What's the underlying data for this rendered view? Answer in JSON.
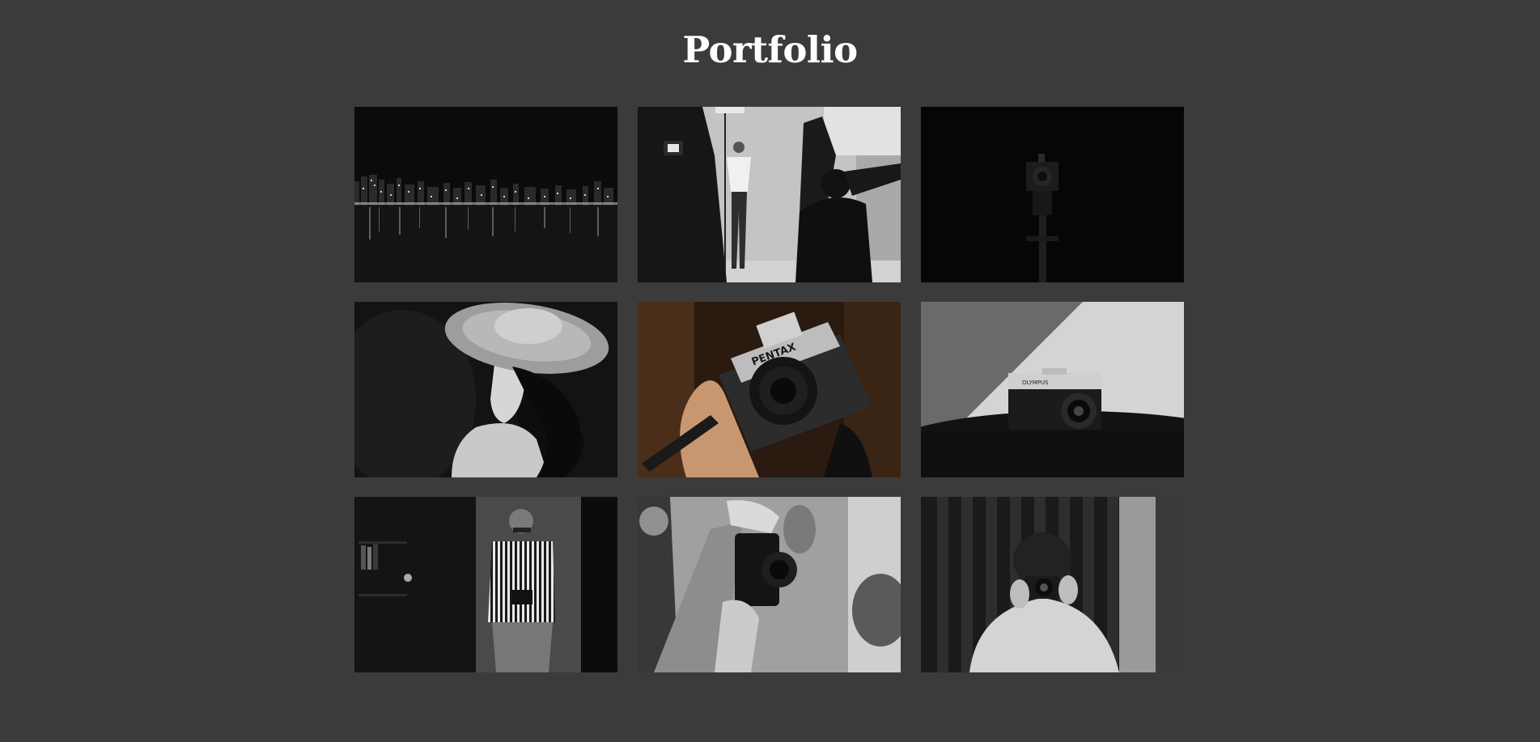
{
  "page": {
    "title": "Portfolio",
    "background": "#3b3b3b",
    "title_color": "#ffffff"
  },
  "gallery": {
    "photos": [
      {
        "name": "photo-city-skyline-night"
      },
      {
        "name": "photo-studio-fashion-shoot"
      },
      {
        "name": "photo-camera-on-tripod-dark"
      },
      {
        "name": "photo-woman-in-sun-hat"
      },
      {
        "name": "photo-hand-holding-pentax-camera",
        "camera_label": "PENTAX"
      },
      {
        "name": "photo-vintage-camera-on-table",
        "camera_label": "OLYMPUS"
      },
      {
        "name": "photo-man-in-striped-shirt-with-camera"
      },
      {
        "name": "photo-photographer-hands-with-camera"
      },
      {
        "name": "photo-person-taking-photo-mirror"
      }
    ]
  }
}
